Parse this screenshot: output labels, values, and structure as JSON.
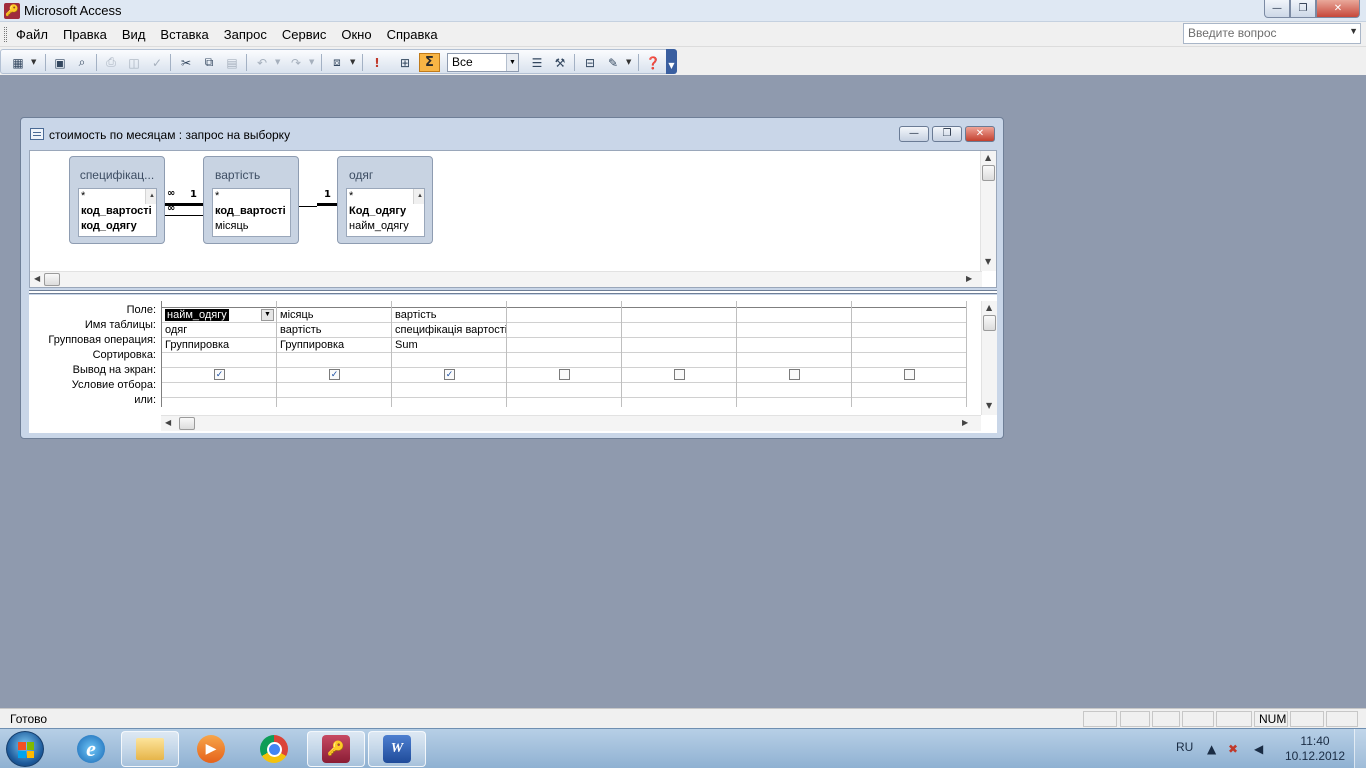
{
  "app": {
    "title": "Microsoft Access"
  },
  "menu": [
    "Файл",
    "Правка",
    "Вид",
    "Вставка",
    "Запрос",
    "Сервис",
    "Окно",
    "Справка"
  ],
  "help_box": {
    "placeholder": "Введите вопрос"
  },
  "toolbar": {
    "sigma_label": "Σ",
    "top_values": "Все"
  },
  "query_window": {
    "title": "стоимость по месяцам : запрос на выборку",
    "tables": [
      {
        "name": "специфікац...",
        "fields": [
          "*",
          "код_вартості",
          "код_одягу"
        ],
        "bold": [
          false,
          true,
          true
        ]
      },
      {
        "name": "вартість",
        "fields": [
          "*",
          "код_вартості",
          "місяць"
        ],
        "bold": [
          false,
          true,
          false
        ]
      },
      {
        "name": "одяг",
        "fields": [
          "*",
          "Код_одягу",
          "найм_одягу"
        ],
        "bold": [
          false,
          true,
          false
        ]
      }
    ],
    "relations": [
      {
        "many": "∞",
        "one": "1"
      },
      {
        "many": "∞",
        "one": "1"
      }
    ],
    "row_labels": [
      "Поле:",
      "Имя таблицы:",
      "Групповая операция:",
      "Сортировка:",
      "Вывод на экран:",
      "Условие отбора:",
      "или:"
    ],
    "columns": [
      {
        "field": "найм_одягу",
        "table": "одяг",
        "group": "Группировка",
        "sort": "",
        "show": true
      },
      {
        "field": "місяць",
        "table": "вартість",
        "group": "Группировка",
        "sort": "",
        "show": true
      },
      {
        "field": "вартість",
        "table": "специфікація вартості",
        "group": "Sum",
        "sort": "",
        "show": true
      },
      {
        "field": "",
        "table": "",
        "group": "",
        "sort": "",
        "show": false
      },
      {
        "field": "",
        "table": "",
        "group": "",
        "sort": "",
        "show": false
      },
      {
        "field": "",
        "table": "",
        "group": "",
        "sort": "",
        "show": false
      },
      {
        "field": "",
        "table": "",
        "group": "",
        "sort": "",
        "show": false
      }
    ]
  },
  "status": {
    "text": "Готово",
    "num": "NUM"
  },
  "taskbar": {
    "lang": "RU",
    "time": "11:40",
    "date": "10.12.2012"
  }
}
